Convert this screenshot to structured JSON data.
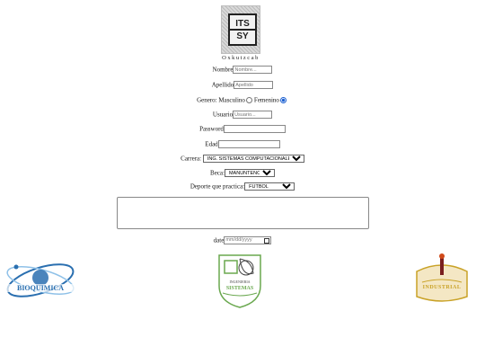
{
  "header": {
    "logo_line1": "ITS",
    "logo_line2": "SY",
    "tagline": "Oxkutzcab"
  },
  "form": {
    "nombre": {
      "label": "Nombre",
      "placeholder": "Nombre..."
    },
    "apellido": {
      "label": "Apellido",
      "placeholder": "Apellido"
    },
    "genero": {
      "label": "Genero:",
      "option1": "Masculino",
      "option2": "Femenino",
      "selected": "Femenino"
    },
    "usuario": {
      "label": "Usuario",
      "placeholder": "Usuario..."
    },
    "password": {
      "label": "Password"
    },
    "edad": {
      "label": "Edad"
    },
    "carrera": {
      "label": "Carrera:",
      "selected": "ING. SISTEMAS COMPUTACIONALES"
    },
    "beca": {
      "label": "Beca:",
      "selected": "MANUNTENCION"
    },
    "deporte": {
      "label": "Deporte que practica:",
      "selected": "FUTBOL"
    },
    "date": {
      "label": "date",
      "placeholder": "mm/dd/yyyy"
    }
  },
  "logos": {
    "left": "BIOQUIMICA",
    "center_line1": "INGENIERIA",
    "center_line2": "SISTEMAS",
    "right": "INDUSTRIAL"
  },
  "colors": {
    "radio_selected": "#1a5fd1",
    "bio_blue": "#2a6fb0",
    "sys_green": "#6aa84f",
    "ind_gold": "#c9a227"
  }
}
